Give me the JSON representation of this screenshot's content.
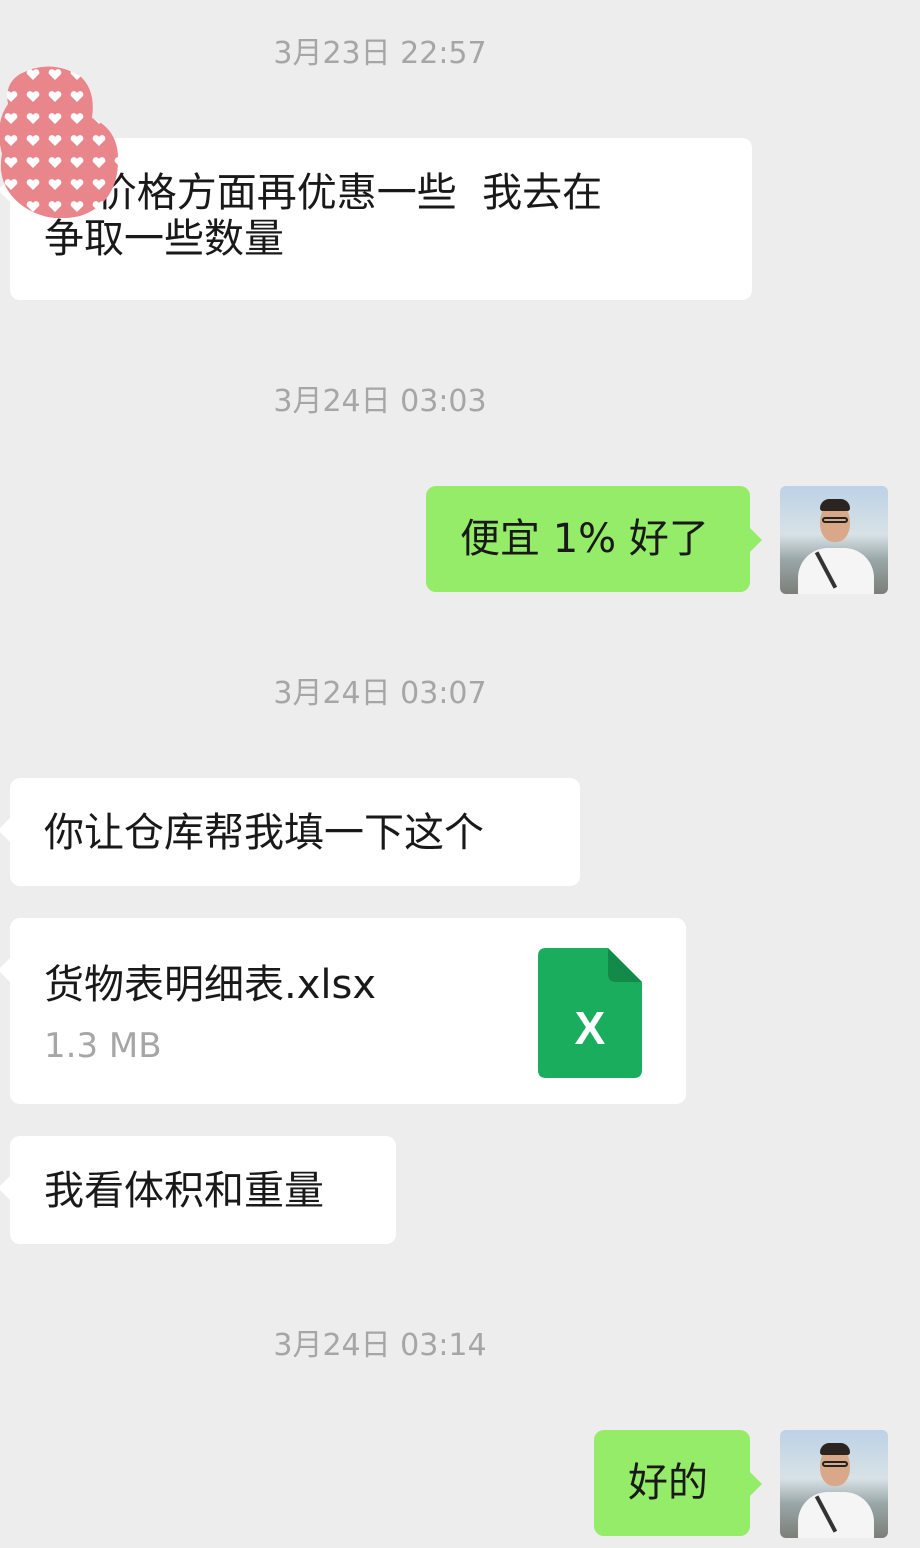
{
  "colors": {
    "background": "#ededed",
    "incoming_bubble": "#ffffff",
    "outgoing_bubble": "#95ec69",
    "timestamp_text": "#a6a6a6",
    "excel_green": "#1aad5e"
  },
  "messages": {
    "ts1": "3月23日 22:57",
    "msg1": "总 价格方面再优惠一些  我去在\n争取一些数量",
    "ts2": "3月24日 03:03",
    "msg2": "便宜 1% 好了",
    "ts3": "3月24日 03:07",
    "msg3": "你让仓库帮我填一下这个",
    "file": {
      "name": "货物表明细表.xlsx",
      "size": "1.3 MB",
      "icon": "excel-file-icon",
      "icon_letter": "X"
    },
    "msg4": "我看体积和重量",
    "ts4": "3月24日 03:14",
    "msg5": "好的"
  },
  "icons": {
    "sender_avatar": "heart-pattern-avatar",
    "self_avatar": "man-with-glasses-avatar"
  }
}
